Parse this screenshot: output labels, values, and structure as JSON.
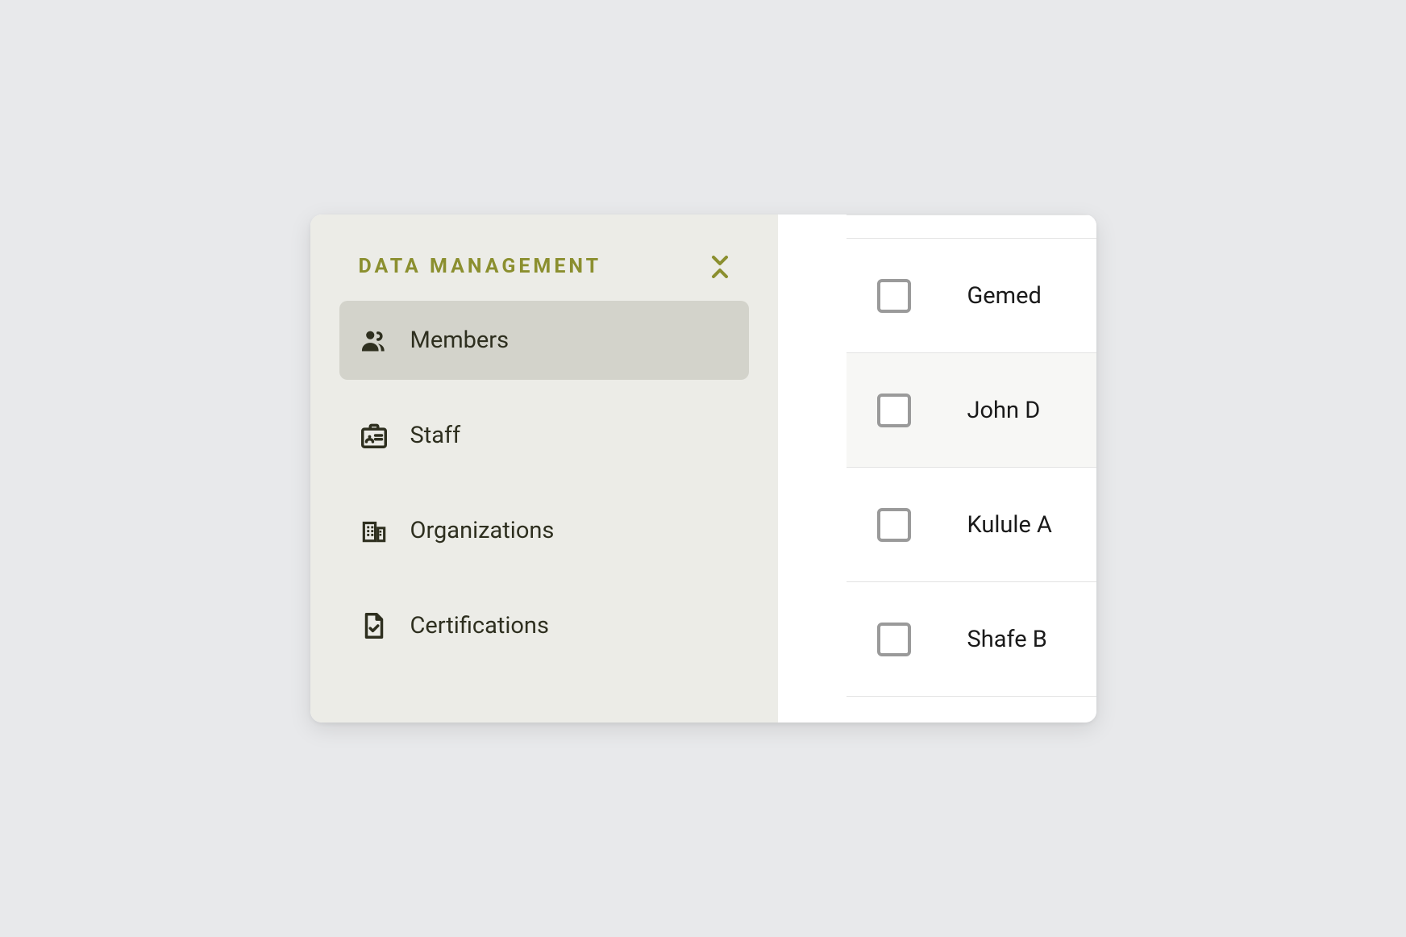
{
  "sidebar": {
    "section_title": "DATA MANAGEMENT",
    "items": [
      {
        "label": "Members",
        "icon": "members-icon",
        "active": true
      },
      {
        "label": "Staff",
        "icon": "staff-icon",
        "active": false
      },
      {
        "label": "Organizations",
        "icon": "organizations-icon",
        "active": false
      },
      {
        "label": "Certifications",
        "icon": "certifications-icon",
        "active": false
      }
    ]
  },
  "main": {
    "rows": [
      {
        "name": "Gemed",
        "checked": false,
        "highlight": false
      },
      {
        "name": "John D",
        "checked": false,
        "highlight": true
      },
      {
        "name": "Kulule A",
        "checked": false,
        "highlight": false
      },
      {
        "name": "Shafe B",
        "checked": false,
        "highlight": false
      }
    ]
  },
  "colors": {
    "accent": "#8b8f2f",
    "sidebar_bg": "#ecece7",
    "active_bg": "#d3d3cb",
    "text_dark": "#2e2f1f"
  }
}
